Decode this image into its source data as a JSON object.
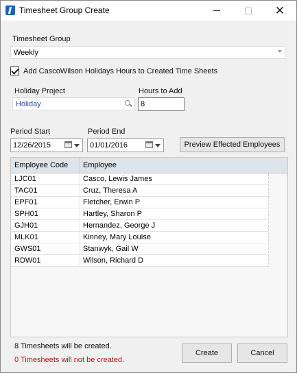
{
  "window": {
    "title": "Timesheet Group Create"
  },
  "timesheet_group": {
    "label": "Timesheet Group",
    "value": "Weekly"
  },
  "holidays_checkbox": {
    "label": "Add CascoWilson Holidays Hours to Created Time Sheets",
    "checked": true
  },
  "holiday_project": {
    "label": "Holiday Project",
    "value": "Holiday"
  },
  "hours_to_add": {
    "label": "Hours to Add",
    "value": "8"
  },
  "period_start": {
    "label": "Period Start",
    "value": "12/26/2015"
  },
  "period_end": {
    "label": "Period End",
    "value": "01/01/2016"
  },
  "preview_button": {
    "label": "Preview Effected Employees"
  },
  "grid": {
    "headers": {
      "code": "Employee Code",
      "name": "Employee"
    },
    "rows": [
      {
        "code": "LJC01",
        "name": "Casco, Lewis James"
      },
      {
        "code": "TAC01",
        "name": "Cruz, Theresa A"
      },
      {
        "code": "EPF01",
        "name": "Fletcher, Erwin P"
      },
      {
        "code": "SPH01",
        "name": "Hartley, Sharon P"
      },
      {
        "code": "GJH01",
        "name": "Hernandez, George J"
      },
      {
        "code": "MLK01",
        "name": "Kinney, Mary Louise"
      },
      {
        "code": "GWS01",
        "name": "Stanwyk, Gail W"
      },
      {
        "code": "RDW01",
        "name": "Wilson, Richard D"
      }
    ]
  },
  "status": {
    "created": "8 Timesheets will be created.",
    "not_created": "0 Timesheets will not be created."
  },
  "buttons": {
    "create": "Create",
    "cancel": "Cancel"
  },
  "colors": {
    "error_text": "#b01818",
    "link_text": "#2b4fb0",
    "grid_header": "#dde4ea"
  }
}
